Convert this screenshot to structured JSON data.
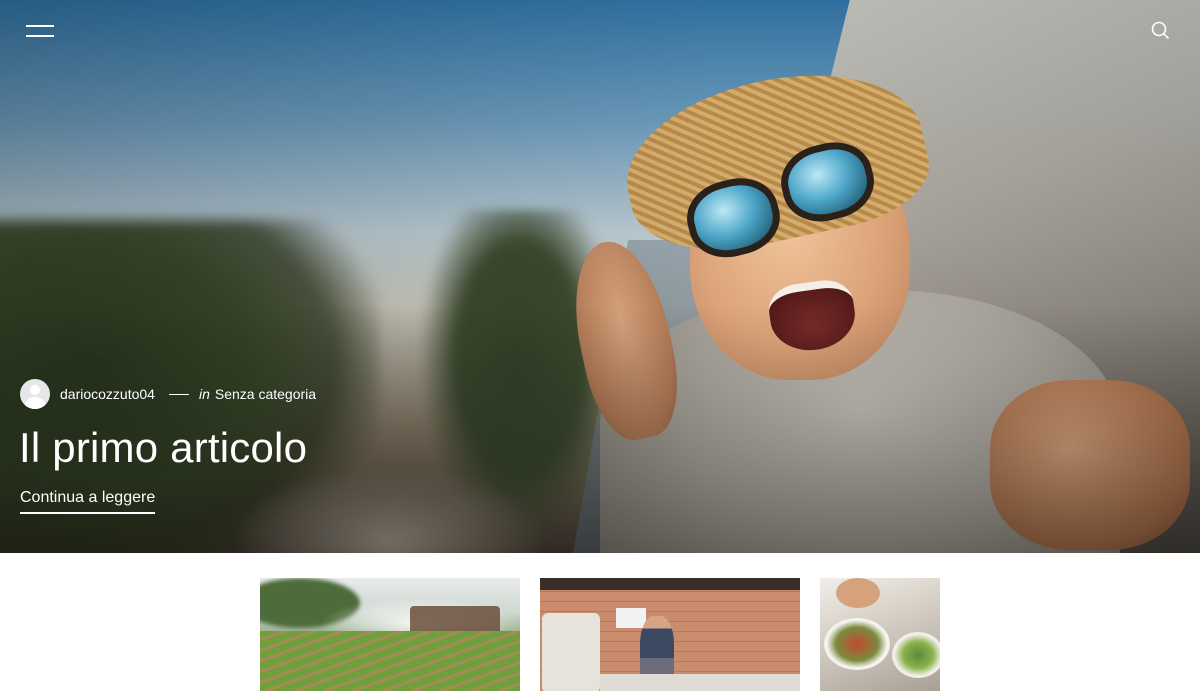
{
  "header": {
    "menu_icon": "hamburger-menu-icon",
    "search_icon": "search-icon"
  },
  "hero": {
    "image_subject": "boy-with-straw-hat-and-sunglasses-in-car-window",
    "author": "dariocozzuto04",
    "in_word": "in",
    "category": "Senza categoria",
    "title": "Il primo articolo",
    "read_more": "Continua a leggere"
  },
  "posts": [
    {
      "image": "rice-terraces-photo"
    },
    {
      "image": "kitchen-person-photo"
    },
    {
      "image": "salad-plates-photo"
    }
  ],
  "colors": {
    "text_on_hero": "#ffffff",
    "page_background": "#ffffff"
  }
}
